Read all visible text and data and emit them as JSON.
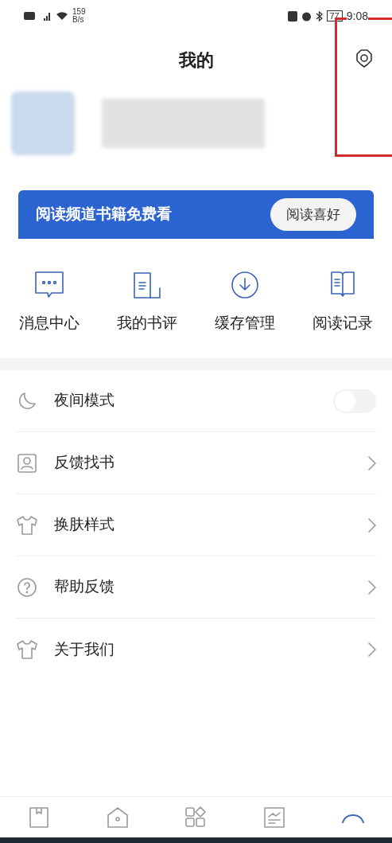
{
  "status_bar": {
    "speed_value": "159",
    "speed_unit": "B/s",
    "battery": "77",
    "time": "9:08"
  },
  "header": {
    "title": "我的"
  },
  "banner": {
    "text": "阅读频道书籍免费看",
    "button": "阅读喜好"
  },
  "quick_actions": [
    {
      "kind": "message",
      "label": "消息中心"
    },
    {
      "kind": "review",
      "label": "我的书评"
    },
    {
      "kind": "download",
      "label": "缓存管理"
    },
    {
      "kind": "book",
      "label": "阅读记录"
    }
  ],
  "menu": [
    {
      "kind": "moon",
      "label": "夜间模式",
      "on": false
    },
    {
      "kind": "card",
      "label": "反馈找书"
    },
    {
      "kind": "shirt",
      "label": "换肤样式"
    },
    {
      "kind": "help",
      "label": "帮助反馈"
    },
    {
      "kind": "shirt",
      "label": "关于我们"
    }
  ],
  "bottom_nav": [
    {
      "kind": "shelf",
      "selected": false
    },
    {
      "kind": "home",
      "selected": false
    },
    {
      "kind": "grid",
      "selected": false
    },
    {
      "kind": "chart",
      "selected": false
    },
    {
      "kind": "arc",
      "selected": true
    }
  ]
}
